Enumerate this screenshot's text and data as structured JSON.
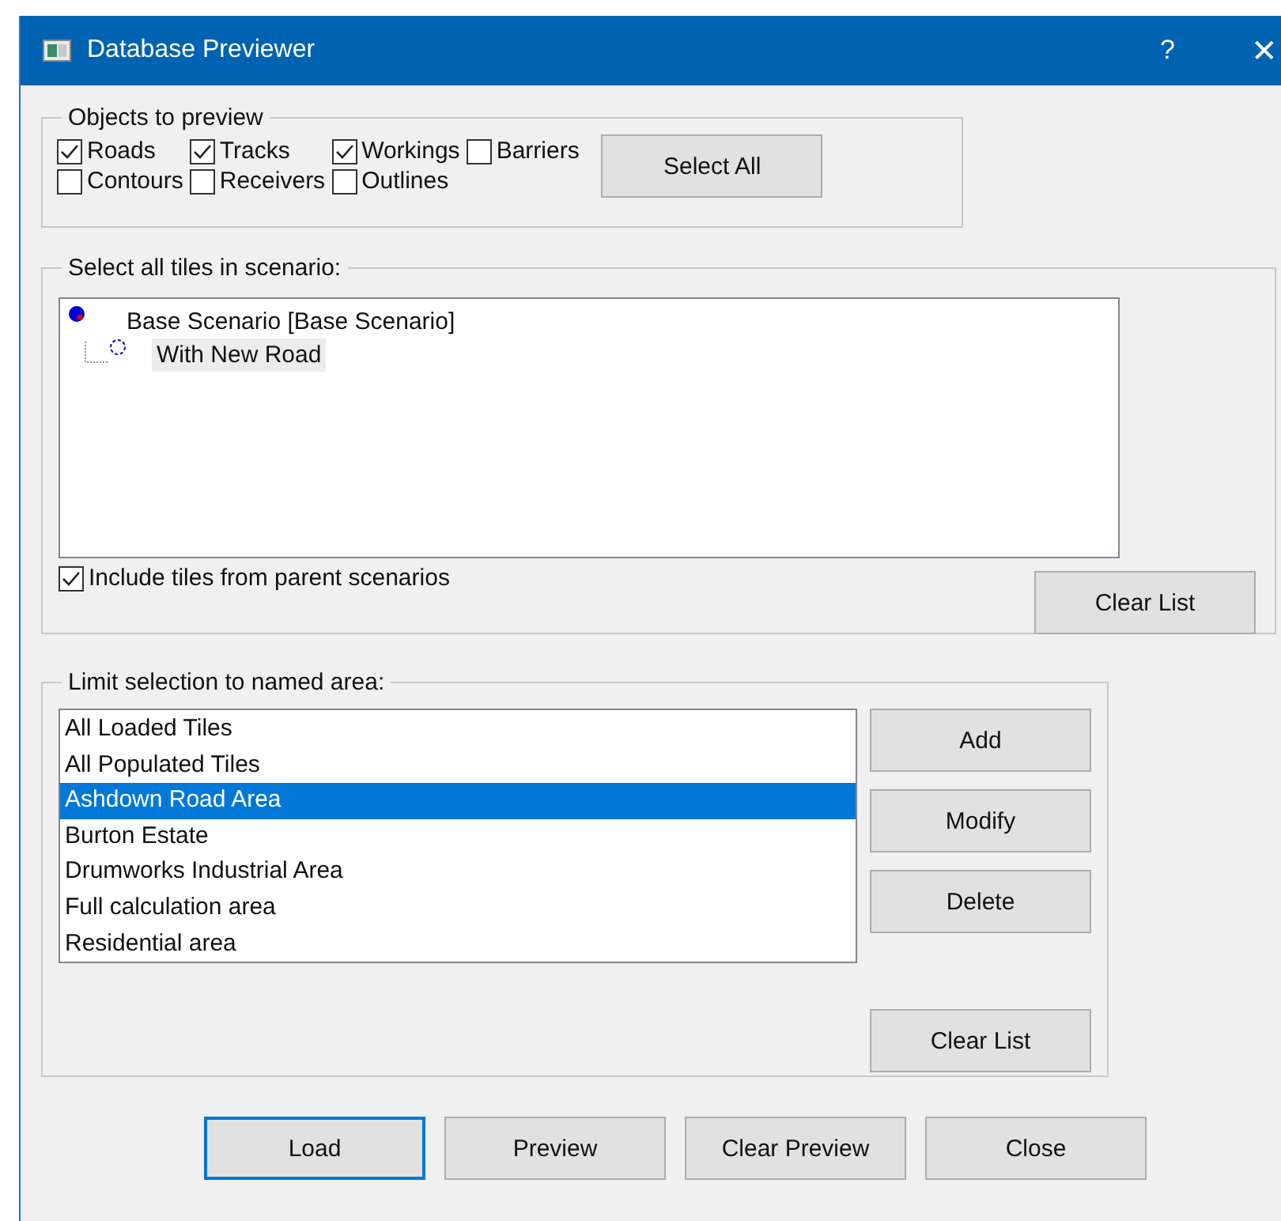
{
  "window": {
    "title": "Database Previewer",
    "help": "?",
    "close": "✕"
  },
  "objects_group": {
    "title": "Objects to preview",
    "rows": [
      [
        {
          "label": "Roads",
          "checked": true
        },
        {
          "label": "Tracks",
          "checked": true
        },
        {
          "label": "Workings",
          "checked": true
        },
        {
          "label": "Barriers",
          "checked": false
        }
      ],
      [
        {
          "label": "Contours",
          "checked": false
        },
        {
          "label": "Receivers",
          "checked": false
        },
        {
          "label": "Outlines",
          "checked": false
        }
      ]
    ],
    "select_all": "Select All"
  },
  "scenario_group": {
    "title": "Select all tiles in scenario:",
    "tree": [
      {
        "label": "Base Scenario [Base Scenario]",
        "filled": true,
        "selected": false,
        "children": [
          {
            "label": "With New Road",
            "filled": false,
            "selected": true
          }
        ]
      }
    ],
    "include_parents": {
      "label": "Include tiles from parent scenarios",
      "checked": true
    },
    "clear_list": "Clear List"
  },
  "area_group": {
    "title": "Limit selection to named area:",
    "items": [
      {
        "label": "All Loaded Tiles",
        "selected": false
      },
      {
        "label": "All Populated Tiles",
        "selected": false
      },
      {
        "label": "Ashdown Road Area",
        "selected": true
      },
      {
        "label": "Burton Estate",
        "selected": false
      },
      {
        "label": "Drumworks Industrial Area",
        "selected": false
      },
      {
        "label": "Full calculation area",
        "selected": false
      },
      {
        "label": "Residential area",
        "selected": false
      }
    ],
    "buttons": [
      "Add",
      "Modify",
      "Delete"
    ],
    "clear_list": "Clear List"
  },
  "buttons": [
    {
      "label": "Load",
      "default": true
    },
    {
      "label": "Preview",
      "default": false
    },
    {
      "label": "Clear Preview",
      "default": false
    },
    {
      "label": "Close",
      "default": false
    }
  ]
}
